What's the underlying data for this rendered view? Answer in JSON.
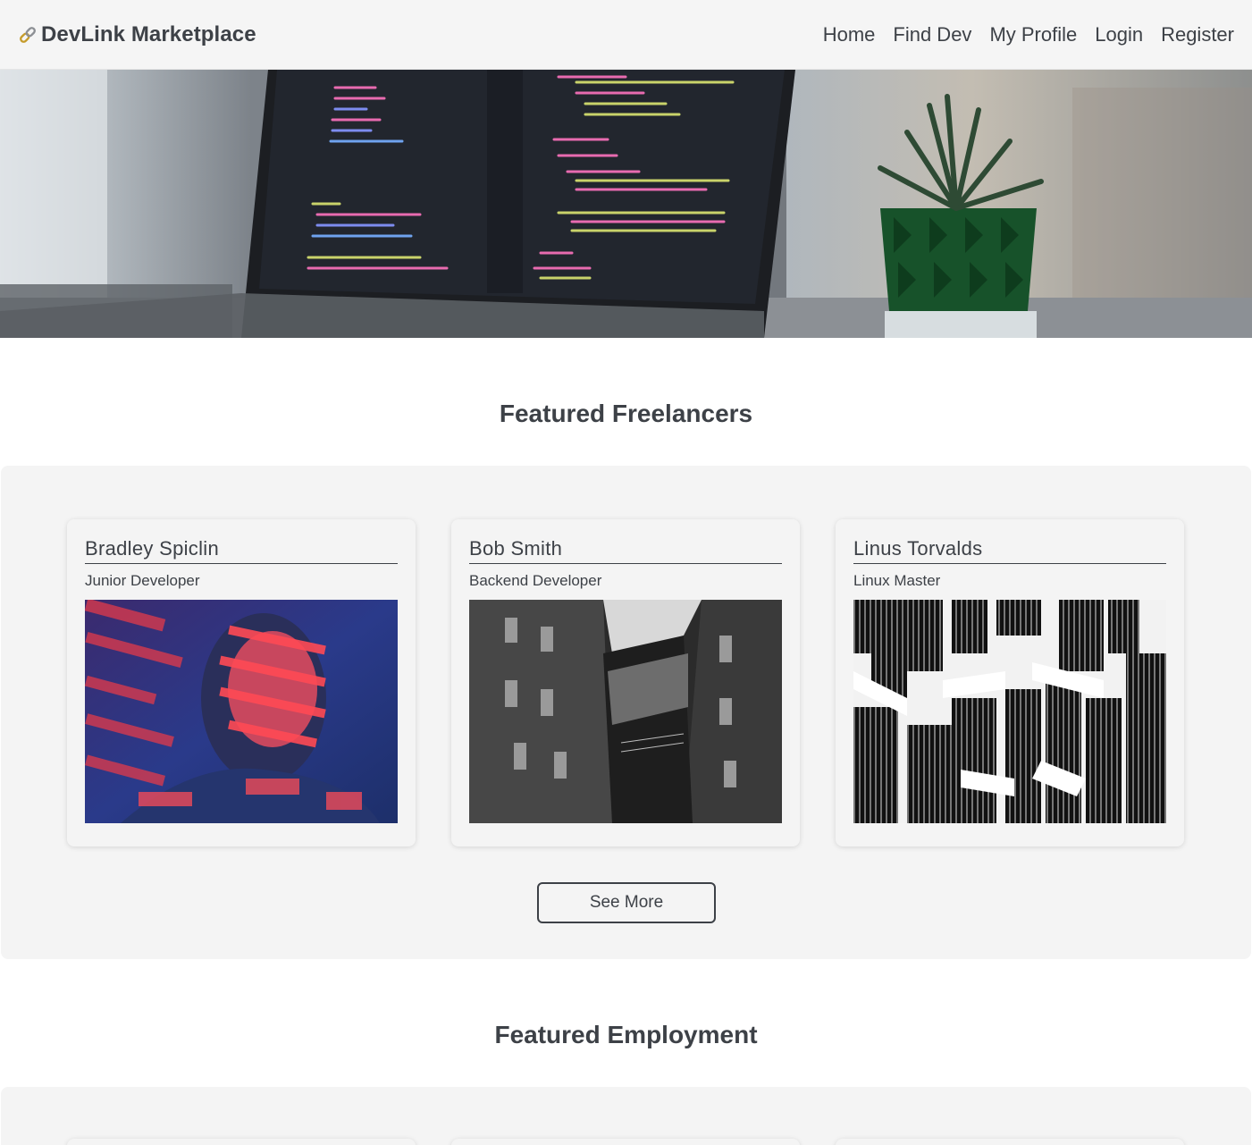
{
  "brand": {
    "icon": "link-icon",
    "name": "DevLink Marketplace"
  },
  "nav": {
    "items": [
      {
        "label": "Home"
      },
      {
        "label": "Find Dev"
      },
      {
        "label": "My Profile"
      },
      {
        "label": "Login"
      },
      {
        "label": "Register"
      }
    ]
  },
  "hero": {
    "image": "laptop-code-photo"
  },
  "freelancers": {
    "title": "Featured Freelancers",
    "cards": [
      {
        "name": "Bradley Spiclin",
        "role": "Junior Developer",
        "photo": "neon-portrait-photo"
      },
      {
        "name": "Bob Smith",
        "role": "Backend Developer",
        "photo": "courtyard-photo"
      },
      {
        "name": "Linus Torvalds",
        "role": "Linux Master",
        "photo": "abstract-architecture-photo"
      }
    ],
    "see_more_label": "See More"
  },
  "employment": {
    "title": "Featured Employment"
  },
  "colors": {
    "text": "#3d4147",
    "panel": "#f4f4f4",
    "navbar": "#f5f5f5"
  }
}
